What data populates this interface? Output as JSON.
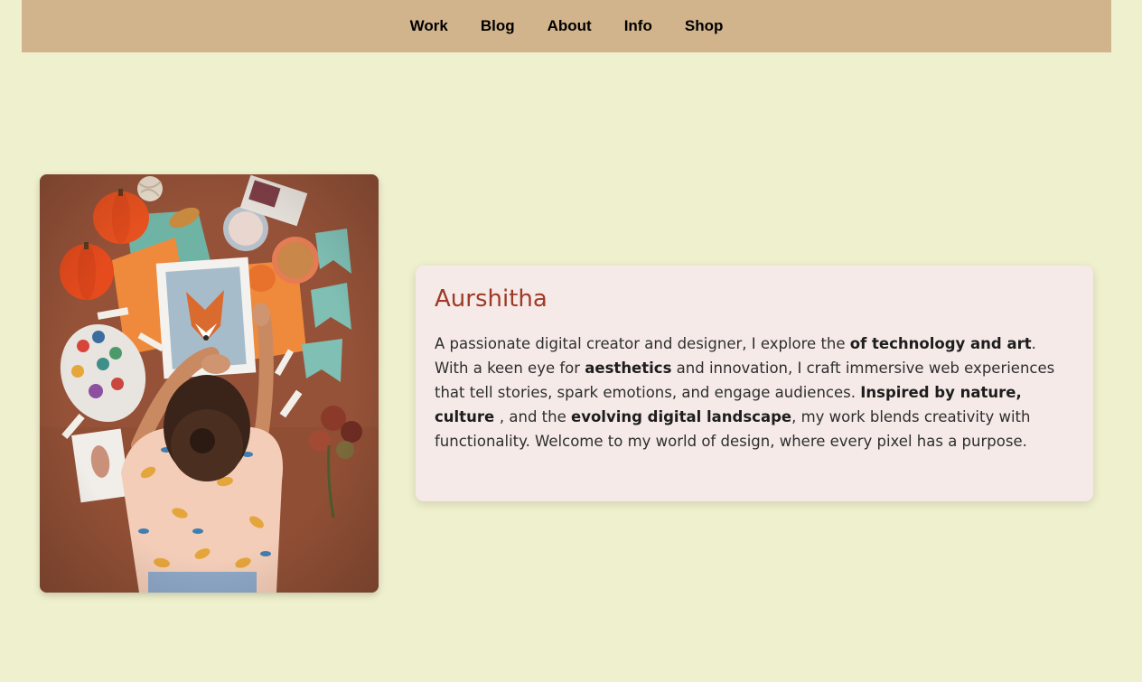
{
  "nav": {
    "items": [
      {
        "label": "Work"
      },
      {
        "label": "Blog"
      },
      {
        "label": "About"
      },
      {
        "label": "Info"
      },
      {
        "label": "Shop"
      }
    ]
  },
  "profile": {
    "photo_alt": "Woman drawing a fox illustration surrounded by pumpkins, paints and art supplies",
    "name": "Aurshitha",
    "bio": {
      "p1": "A passionate digital creator and designer, I explore the ",
      "b1": "of technology and art",
      "p2": ". With a keen eye for ",
      "b2": "aesthetics",
      "p3": " and innovation, I craft immersive web experiences that tell stories, spark emotions, and engage audiences. ",
      "b3": "Inspired by nature, culture ",
      "p4": ", and the ",
      "b4": "evolving digital landscape",
      "p5": ", my work blends creativity with functionality. Welcome to my world of design, where every pixel has a purpose."
    }
  },
  "colors": {
    "page_bg": "#eff0cd",
    "nav_bg": "#d2b48c",
    "card_bg": "#f5eae8",
    "name_color": "#a03a26",
    "text_color": "#2e2e2e"
  }
}
